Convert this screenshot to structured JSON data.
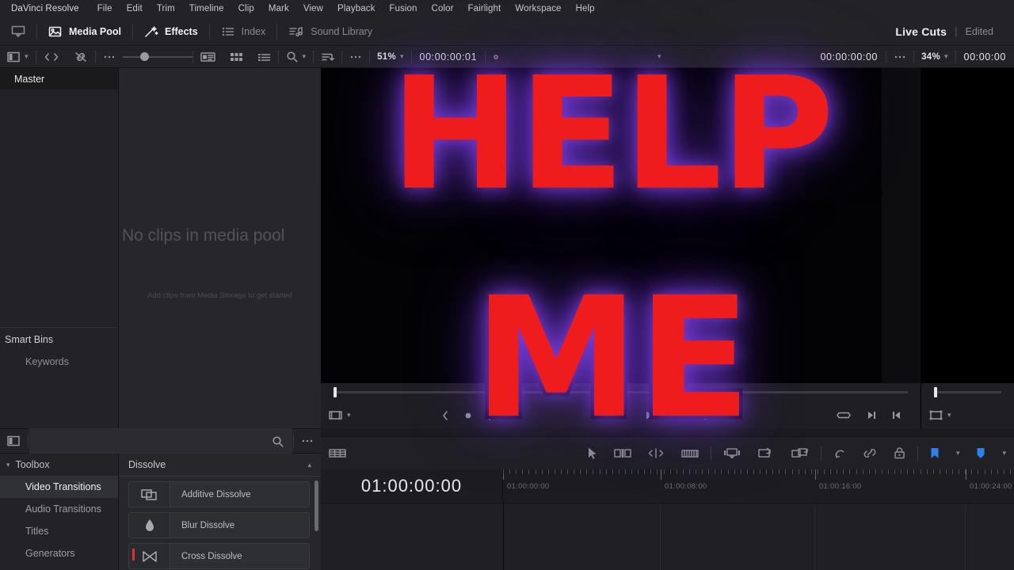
{
  "menubar": {
    "items": [
      {
        "label": "DaVinci Resolve"
      },
      {
        "label": "File"
      },
      {
        "label": "Edit"
      },
      {
        "label": "Trim"
      },
      {
        "label": "Timeline"
      },
      {
        "label": "Clip"
      },
      {
        "label": "Mark"
      },
      {
        "label": "View"
      },
      {
        "label": "Playback"
      },
      {
        "label": "Fusion"
      },
      {
        "label": "Color"
      },
      {
        "label": "Fairlight"
      },
      {
        "label": "Workspace"
      },
      {
        "label": "Help"
      }
    ]
  },
  "toolbar": {
    "media_pool_label": "Media Pool",
    "effects_label": "Effects",
    "index_label": "Index",
    "sound_library_label": "Sound Library",
    "project_title": "Live Cuts",
    "project_divider": "|",
    "project_status": "Edited"
  },
  "subbar": {
    "zoom_left": "51%",
    "timecode_left": "00:00:00:01",
    "timecode_right": "00:00:00:00",
    "zoom_right": "34%",
    "timecode_far_right": "00:00:00"
  },
  "bins": {
    "master_label": "Master",
    "smart_bins_label": "Smart Bins",
    "keywords_label": "Keywords"
  },
  "pool": {
    "empty_title": "No clips in media pool",
    "empty_subtitle": "Add clips from Media Storage to get started"
  },
  "viewer": {
    "overlay_line1": "HELP",
    "overlay_line2": "ME",
    "overlay_text_color": "#ee1c1c",
    "overlay_glow_color": "#7c3ede",
    "overlay_outline_color": "#07060c"
  },
  "timeline": {
    "current_timecode": "01:00:00:00",
    "ruler_labels": [
      "01:00:00:00",
      "01:00:08:00",
      "01:00:16:00",
      "01:00:24:00"
    ],
    "marker_color": "#2f7fe8",
    "shield_color": "#2f7fe8"
  },
  "effects": {
    "toolbox_label": "Toolbox",
    "items": [
      {
        "label": "Video Transitions",
        "selected": true
      },
      {
        "label": "Audio Transitions",
        "selected": false
      },
      {
        "label": "Titles",
        "selected": false
      },
      {
        "label": "Generators",
        "selected": false
      }
    ],
    "group_label": "Dissolve",
    "transitions": [
      {
        "label": "Additive Dissolve",
        "marked": false
      },
      {
        "label": "Blur Dissolve",
        "marked": false
      },
      {
        "label": "Cross Dissolve",
        "marked": true
      }
    ]
  }
}
